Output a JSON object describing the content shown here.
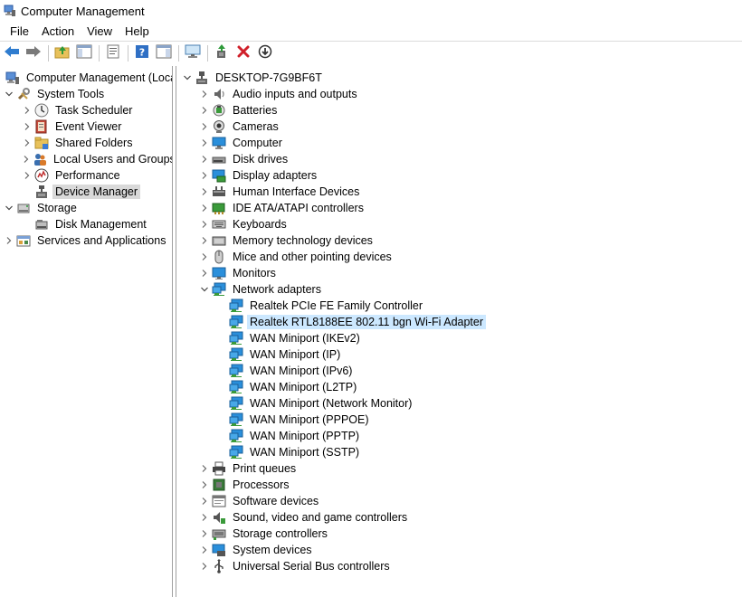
{
  "window": {
    "title": "Computer Management"
  },
  "menu": [
    "File",
    "Action",
    "View",
    "Help"
  ],
  "toolbar": [
    {
      "icon": "back-arrow-icon"
    },
    {
      "icon": "forward-arrow-icon"
    },
    {
      "icon": "up-folder-icon"
    },
    {
      "icon": "show-hide-console-tree-icon"
    },
    {
      "icon": "properties-icon"
    },
    {
      "icon": "help-icon"
    },
    {
      "icon": "show-hide-action-pane-icon"
    },
    {
      "icon": "monitor-icon"
    },
    {
      "icon": "update-driver-icon"
    },
    {
      "icon": "uninstall-device-icon"
    },
    {
      "icon": "scan-hardware-icon"
    }
  ],
  "left_tree": [
    {
      "label": "Computer Management (Local",
      "level": 0,
      "expander": "none",
      "icon": "computer-management-icon"
    },
    {
      "label": "System Tools",
      "level": 0,
      "expander": "open",
      "icon": "system-tools-icon"
    },
    {
      "label": "Task Scheduler",
      "level": 1,
      "expander": "closed",
      "icon": "task-scheduler-icon"
    },
    {
      "label": "Event Viewer",
      "level": 1,
      "expander": "closed",
      "icon": "event-viewer-icon"
    },
    {
      "label": "Shared Folders",
      "level": 1,
      "expander": "closed",
      "icon": "shared-folders-icon"
    },
    {
      "label": "Local Users and Groups",
      "level": 1,
      "expander": "closed",
      "icon": "users-icon"
    },
    {
      "label": "Performance",
      "level": 1,
      "expander": "closed",
      "icon": "performance-icon"
    },
    {
      "label": "Device Manager",
      "level": 1,
      "expander": "none",
      "icon": "device-manager-icon",
      "selected": true
    },
    {
      "label": "Storage",
      "level": 0,
      "expander": "open",
      "icon": "storage-icon"
    },
    {
      "label": "Disk Management",
      "level": 1,
      "expander": "none",
      "icon": "disk-management-icon"
    },
    {
      "label": "Services and Applications",
      "level": 0,
      "expander": "closed",
      "icon": "services-icon"
    }
  ],
  "device_tree": {
    "root": "DESKTOP-7G9BF6T",
    "categories": [
      {
        "label": "Audio inputs and outputs",
        "icon": "audio-icon"
      },
      {
        "label": "Batteries",
        "icon": "battery-icon"
      },
      {
        "label": "Cameras",
        "icon": "camera-icon"
      },
      {
        "label": "Computer",
        "icon": "computer-icon"
      },
      {
        "label": "Disk drives",
        "icon": "disk-drive-icon"
      },
      {
        "label": "Display adapters",
        "icon": "display-adapter-icon"
      },
      {
        "label": "Human Interface Devices",
        "icon": "hid-icon"
      },
      {
        "label": "IDE ATA/ATAPI controllers",
        "icon": "ide-controller-icon"
      },
      {
        "label": "Keyboards",
        "icon": "keyboard-icon"
      },
      {
        "label": "Memory technology devices",
        "icon": "memory-icon"
      },
      {
        "label": "Mice and other pointing devices",
        "icon": "mouse-icon"
      },
      {
        "label": "Monitors",
        "icon": "monitor-icon"
      },
      {
        "label": "Network adapters",
        "icon": "network-adapter-icon",
        "expanded": true,
        "children": [
          {
            "label": "Realtek PCIe FE Family Controller"
          },
          {
            "label": "Realtek RTL8188EE 802.11 bgn Wi-Fi Adapter",
            "selected": true
          },
          {
            "label": "WAN Miniport (IKEv2)"
          },
          {
            "label": "WAN Miniport (IP)"
          },
          {
            "label": "WAN Miniport (IPv6)"
          },
          {
            "label": "WAN Miniport (L2TP)"
          },
          {
            "label": "WAN Miniport (Network Monitor)"
          },
          {
            "label": "WAN Miniport (PPPOE)"
          },
          {
            "label": "WAN Miniport (PPTP)"
          },
          {
            "label": "WAN Miniport (SSTP)"
          }
        ]
      },
      {
        "label": "Print queues",
        "icon": "printer-icon"
      },
      {
        "label": "Processors",
        "icon": "processor-icon"
      },
      {
        "label": "Software devices",
        "icon": "software-device-icon"
      },
      {
        "label": "Sound, video and game controllers",
        "icon": "sound-icon"
      },
      {
        "label": "Storage controllers",
        "icon": "storage-controller-icon"
      },
      {
        "label": "System devices",
        "icon": "system-devices-icon"
      },
      {
        "label": "Universal Serial Bus controllers",
        "icon": "usb-icon"
      }
    ]
  }
}
